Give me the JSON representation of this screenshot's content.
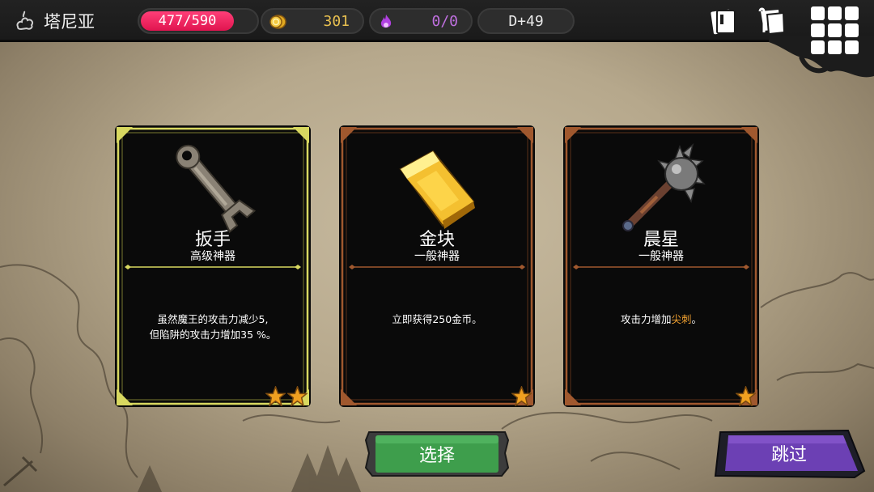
{
  "location": {
    "name": "塔尼亚",
    "icon": "poison-cloud-icon"
  },
  "stats": {
    "hp": "477/590",
    "hp_fraction": 0.81,
    "gold": "301",
    "mana": "0/0",
    "day": "D+49"
  },
  "top_icons": [
    "deck-icon",
    "map-scroll-icon",
    "menu-grid-icon"
  ],
  "colors": {
    "hp": "#e0144f",
    "gold": "#e8c050",
    "mana": "#c070e0",
    "legendary_frame": "#d4d45a",
    "common_frame": "#a05a30",
    "select_button": "#3a9a48",
    "skip_button": "#6a3fb0",
    "keyword": "#f0a030"
  },
  "cards": [
    {
      "name": "扳手",
      "rarity": "高级神器",
      "desc_line1": "虽然魔王的攻击力减少5,",
      "desc_line2": "但陷阱的攻击力增加35 %。",
      "stars": 2,
      "art": "wrench-icon"
    },
    {
      "name": "金块",
      "rarity": "一般神器",
      "desc_line1": "立即获得250金币。",
      "stars": 1,
      "art": "gold-bar-icon"
    },
    {
      "name": "晨星",
      "rarity": "一般神器",
      "desc_pre": "攻击力增加",
      "desc_kw": "尖刺",
      "desc_post": "。",
      "stars": 1,
      "art": "morning-star-icon"
    }
  ],
  "buttons": {
    "select": "选择",
    "skip": "跳过"
  }
}
